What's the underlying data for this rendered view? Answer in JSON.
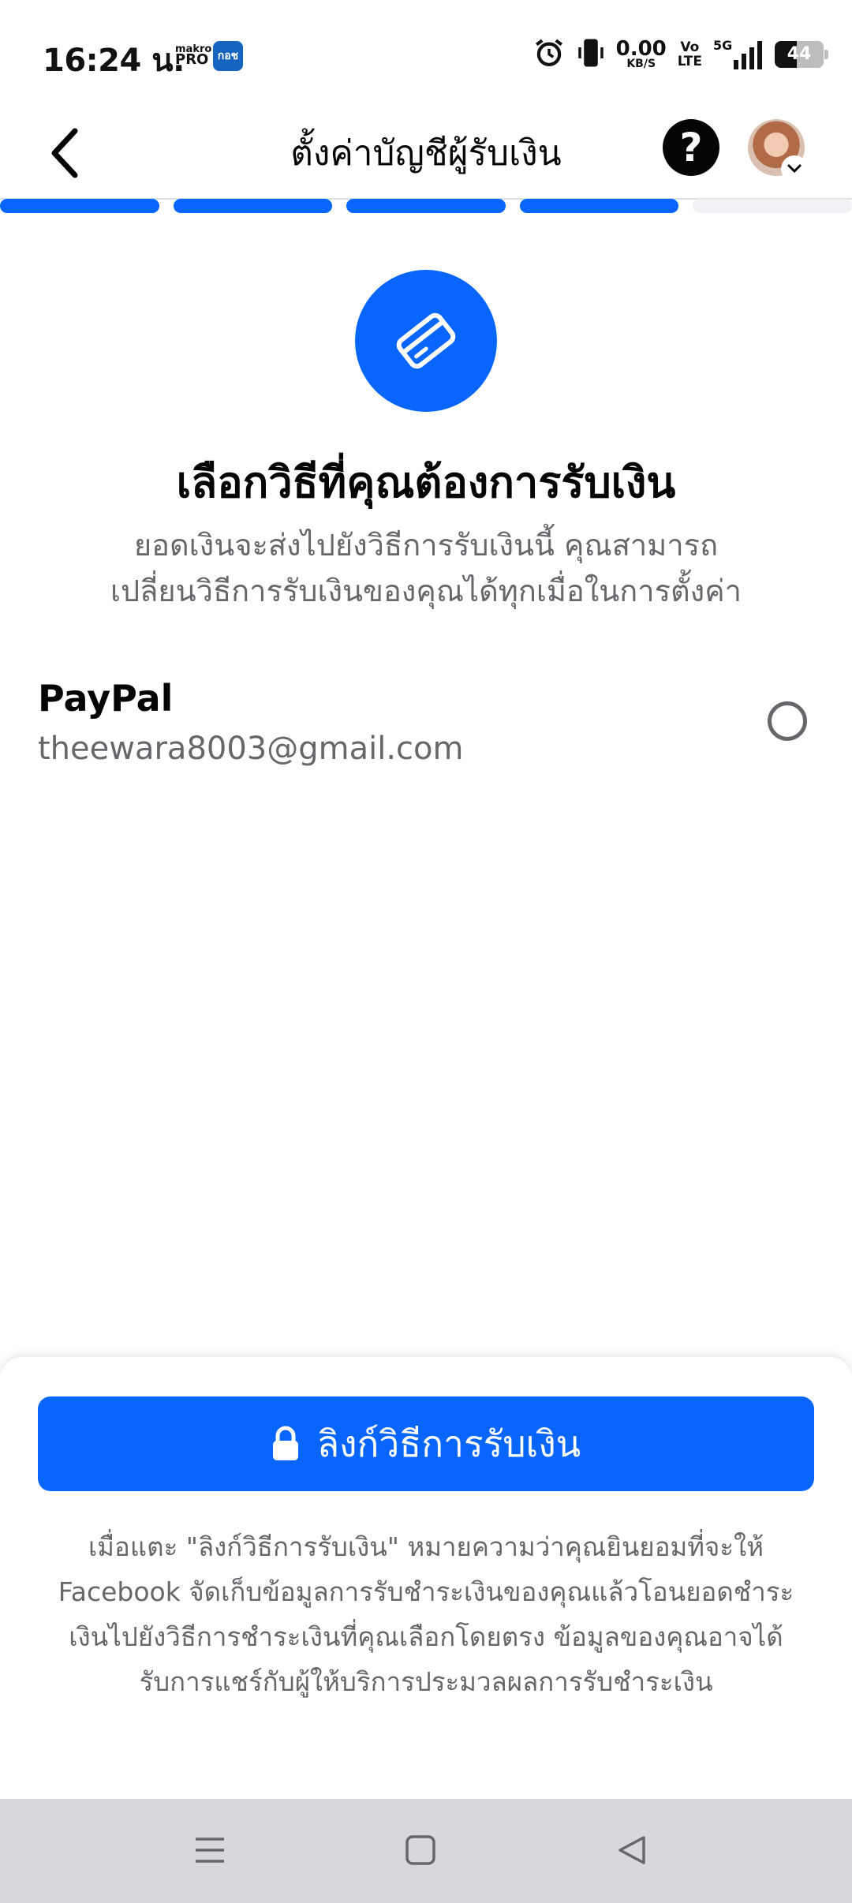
{
  "status_bar": {
    "time": "16:24 น.",
    "makro_top": "makro",
    "makro_bottom": "PRO",
    "app_badge": "กอช",
    "net_speed": "0.00",
    "net_unit": "KB/S",
    "volte_top": "Vo",
    "volte_bottom": "LTE",
    "signal_type": "5G",
    "battery": "44",
    "icons": [
      "alarm-icon",
      "vibrate-icon",
      "signal-icon",
      "battery-icon"
    ]
  },
  "header": {
    "title": "ตั้งค่าบัญชีผู้รับเงิน",
    "help_label": "?",
    "back_icon": "chevron-left-icon",
    "avatar_icon": "avatar"
  },
  "progress": {
    "total_steps": 5,
    "completed_steps": 4
  },
  "hero": {
    "icon": "credit-card-icon",
    "title": "เลือกวิธีที่คุณต้องการรับเงิน",
    "subtitle_line1": "ยอดเงินจะส่งไปยังวิธีการรับเงินนี้ คุณสามารถ",
    "subtitle_line2": "เปลี่ยนวิธีการรับเงินของคุณได้ทุกเมื่อในการตั้งค่า"
  },
  "payout_methods": [
    {
      "name": "PayPal",
      "account": "theewara8003@gmail.com",
      "selected": false
    }
  ],
  "bottom": {
    "link_button_label": "ลิงก์วิธีการรับเงิน",
    "link_button_icon": "lock-icon",
    "disclaimer": [
      "เมื่อแตะ \"ลิงก์วิธีการรับเงิน\" หมายความว่าคุณยินยอมที่จะให้",
      "Facebook จัดเก็บข้อมูลการรับชำระเงินของคุณแล้วโอนยอดชำระ",
      "เงินไปยังวิธีการชำระเงินที่คุณเลือกโดยตรง ข้อมูลของคุณอาจได้",
      "รับการแชร์กับผู้ให้บริการประมวลผลการรับชำระเงิน"
    ]
  },
  "colors": {
    "accent": "#0866ff",
    "text_primary": "#050505",
    "text_secondary": "#65676b",
    "progress_inactive": "#f0f2f5",
    "nav_bar": "#d8d8dc"
  },
  "nav_bar": {
    "icons": [
      "recent-apps-icon",
      "home-icon",
      "back-icon"
    ]
  }
}
